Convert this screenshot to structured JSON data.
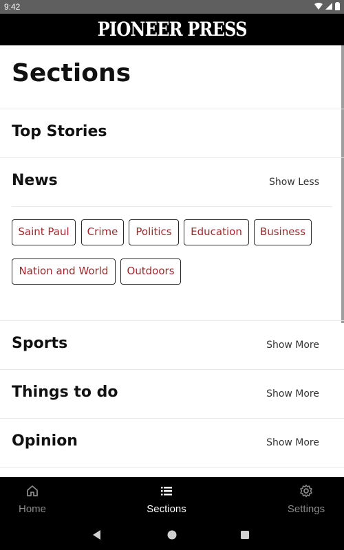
{
  "status_bar": {
    "time": "9:42"
  },
  "header": {
    "logo": "PIONEER PRESS"
  },
  "page": {
    "title": "Sections"
  },
  "sections": [
    {
      "name": "Top Stories",
      "toggle": ""
    },
    {
      "name": "News",
      "toggle": "Show Less"
    },
    {
      "name": "Sports",
      "toggle": "Show More"
    },
    {
      "name": "Things to do",
      "toggle": "Show More"
    },
    {
      "name": "Opinion",
      "toggle": "Show More"
    }
  ],
  "news_subsections": [
    "Saint Paul",
    "Crime",
    "Politics",
    "Education",
    "Business",
    "Nation and World",
    "Outdoors"
  ],
  "bottom_nav": [
    {
      "label": "Home",
      "icon": "home-icon",
      "active": false
    },
    {
      "label": "Sections",
      "icon": "list-icon",
      "active": true
    },
    {
      "label": "Settings",
      "icon": "gear-icon",
      "active": false
    }
  ],
  "colors": {
    "chip_text": "#a0262b",
    "header_bg": "#000000"
  }
}
